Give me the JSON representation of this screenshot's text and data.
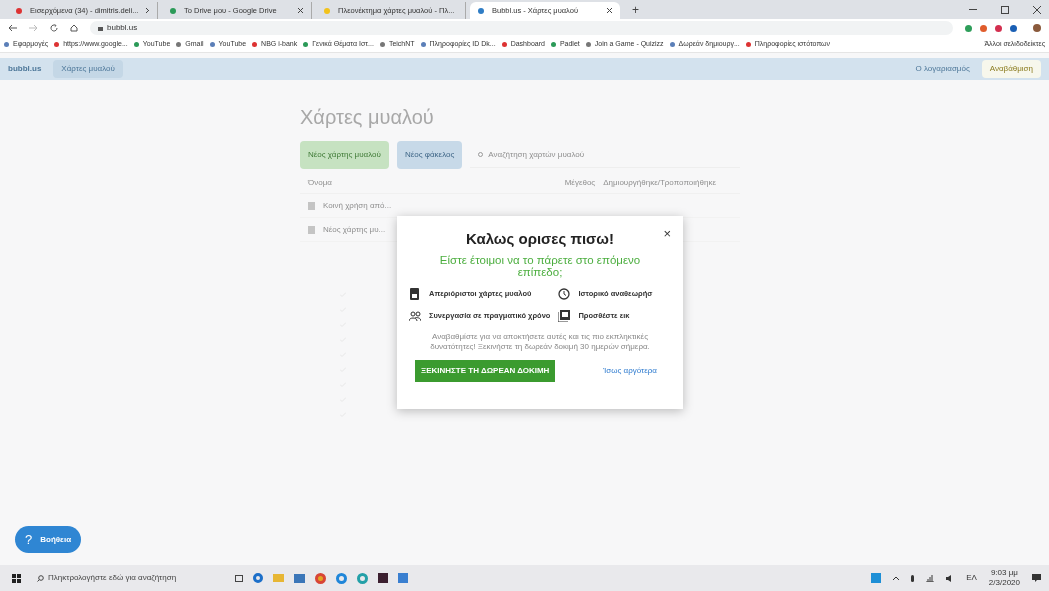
{
  "browser": {
    "tabs": [
      {
        "title": "Εισερχόμενα (34) - dimitris.deli...",
        "selected": false
      },
      {
        "title": "Το Drive μου - Google Drive",
        "selected": false
      },
      {
        "title": "Πλεονέκτημα χάρτες μυαλού - Πλ...",
        "selected": false
      },
      {
        "title": "Bubbl.us - Χάρτες μυαλού",
        "selected": true
      }
    ],
    "new_tab": "+",
    "address": "bubbl.us",
    "bookmarks": [
      "Εφαρμογές",
      "https://www.google...",
      "YouTube",
      "Gmail",
      "YouTube",
      "NBG i-bank",
      "Γενικά Θέματα Ιστ...",
      "TeichNT",
      "Πληροφορίες ID Dk...",
      "Dashboard",
      "Padlet",
      "Join a Game - Quizizz",
      "Δωρεάν δημιουργ...",
      "Πληροφορίες ιστότοπων"
    ],
    "other_bookmarks": "Άλλοι σελιδοδείκτες"
  },
  "app": {
    "logo": "bubbl.us",
    "header_tab": "Χάρτες μυαλού",
    "account": "Ο λογαριασμός",
    "upgrade": "Αναβάθμιση"
  },
  "page": {
    "title": "Χάρτες μυαλού",
    "new_map_button": "Νέος χάρτης μυαλού",
    "new_folder_button": "Νέος φάκελος",
    "search": {
      "placeholder": "Αναζήτηση χαρτών μυαλού"
    },
    "columns": [
      "Όνομα",
      "Μέγεθος",
      "Δημιουργήθηκε/Τροποποιήθηκε"
    ],
    "files": [
      {
        "name": "Κοινή χρήση από..."
      },
      {
        "name": "Νέος χάρτης μυ..."
      }
    ]
  },
  "modal": {
    "title": "Καλως ορισες πισω!",
    "close": "×",
    "subtitle": "Είστε έτοιμοι να το πάρετε στο επόμενο επίπεδο;",
    "features": [
      {
        "kind": "maps",
        "label": "Απεριόριστοι χάρτες μυαλού"
      },
      {
        "kind": "history",
        "label": "Ιστορικό αναθεωρήσ"
      },
      {
        "kind": "collab",
        "label": "Συνεργασία σε πραγματικό χρόνο"
      },
      {
        "kind": "image",
        "label": "Προσθέστε εικ"
      }
    ],
    "body": "Αναβαθμίστε για να αποκτήσετε αυτές και τις πιο εκπληκτικές δυνατότητες! Ξεκινήστε τη δωρεάν δοκιμή 30 ημερών σήμερα.",
    "primary_button": "ΞΕΚΙΝΗΣΤΕ ΤΗ ΔΩΡΕΑΝ ΔΟΚΙΜΗ",
    "secondary_link": "Ίσως αργότερα"
  },
  "help_icon": "?",
  "help_button": "Βοήθεια",
  "taskbar": {
    "search_placeholder": "Πληκτρολογήστε εδώ για αναζήτηση",
    "language": "ΕΛ",
    "time": "9:03 μμ",
    "date": "2/3/2020"
  }
}
